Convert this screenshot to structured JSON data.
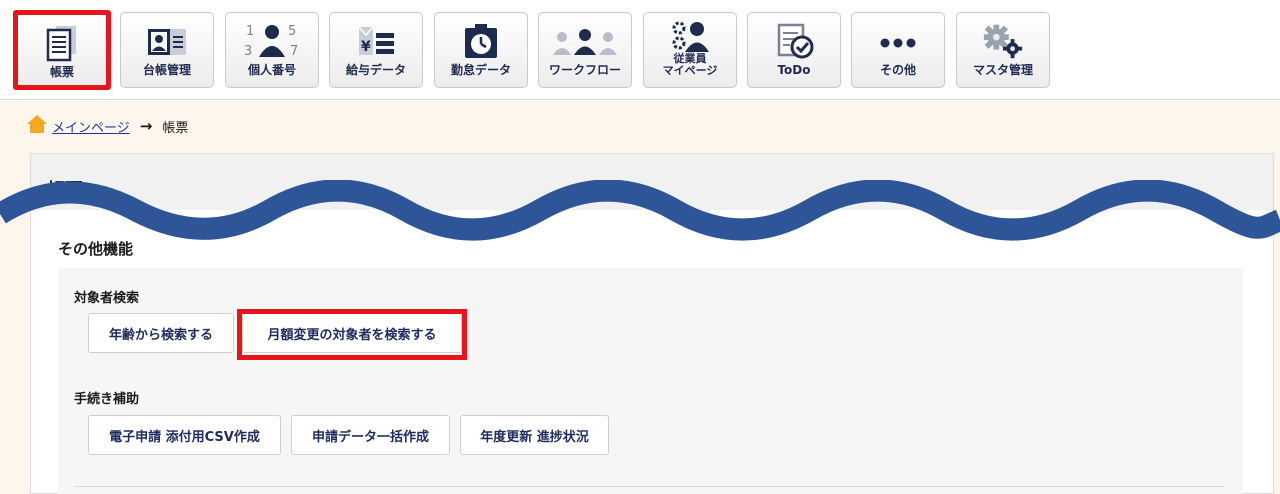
{
  "toolbar": {
    "items": [
      {
        "label": "帳票",
        "icon": "document-list-icon"
      },
      {
        "label": "台帳管理",
        "icon": "id-card-icon"
      },
      {
        "label": "個人番号",
        "icon": "person-number-icon",
        "digits": [
          "1",
          "5",
          "3",
          "7"
        ]
      },
      {
        "label": "給与データ",
        "icon": "salary-yen-icon",
        "symbol": "¥"
      },
      {
        "label": "勤怠データ",
        "icon": "timecard-clock-icon"
      },
      {
        "label": "ワークフロー",
        "icon": "workflow-people-icon"
      },
      {
        "label_line1": "従業員",
        "label_line2": "マイページ",
        "icon": "employee-mypage-icon"
      },
      {
        "label": "ToDo",
        "icon": "todo-check-icon"
      },
      {
        "label": "その他",
        "icon": "more-dots-icon"
      },
      {
        "label": "マスタ管理",
        "icon": "gears-icon"
      }
    ]
  },
  "breadcrumb": {
    "home_link": "メインページ",
    "current": "帳票"
  },
  "panel": {
    "title": "帳票",
    "section_title": "その他機能",
    "groups": [
      {
        "title": "対象者検索",
        "buttons": [
          "年齢から検索する",
          "月額変更の対象者を検索する"
        ]
      },
      {
        "title": "手続き補助",
        "buttons": [
          "電子申請 添付用CSV作成",
          "申請データ一括作成",
          "年度更新 進捗状況"
        ]
      }
    ]
  },
  "colors": {
    "highlight": "#e8141b",
    "wave": "#2d5597",
    "icon_navy": "#1f2a4f",
    "content_bg": "#fdf6ec"
  }
}
